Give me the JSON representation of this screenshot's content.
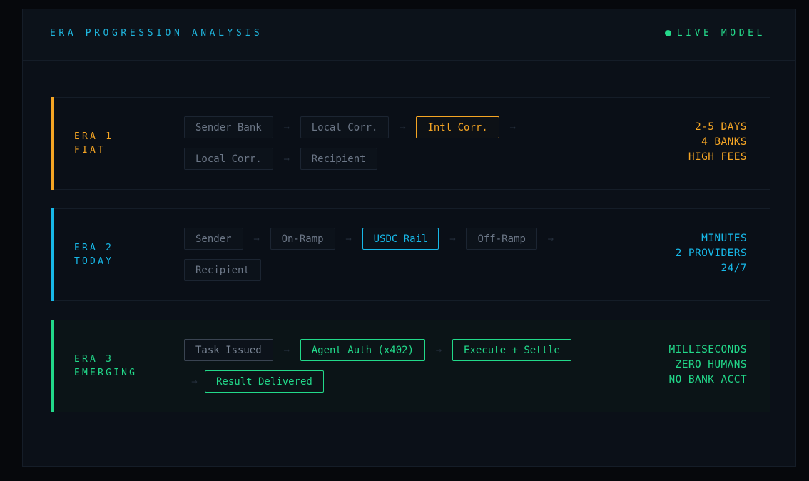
{
  "header": {
    "title": "ERA PROGRESSION ANALYSIS",
    "status": "LIVE MODEL"
  },
  "colors": {
    "era1": "#f5a524",
    "era2": "#17b8e8",
    "era3": "#22d98a",
    "muted": "#6c7787"
  },
  "eras": [
    {
      "label_line1": "ERA 1",
      "label_line2": "FIAT",
      "flow": [
        "Sender Bank",
        "Local Corr.",
        "Intl Corr.",
        "Local Corr.",
        "Recipient"
      ],
      "highlighted": "Intl Corr.",
      "stats": [
        "2-5 DAYS",
        "4 BANKS",
        "HIGH FEES"
      ]
    },
    {
      "label_line1": "ERA 2",
      "label_line2": "TODAY",
      "flow": [
        "Sender",
        "On-Ramp",
        "USDC Rail",
        "Off-Ramp",
        "Recipient"
      ],
      "highlighted": "USDC Rail",
      "stats": [
        "MINUTES",
        "2 PROVIDERS",
        "24/7"
      ]
    },
    {
      "label_line1": "ERA 3",
      "label_line2": "EMERGING",
      "flow": [
        "Task Issued",
        "Agent Auth (x402)",
        "Execute + Settle",
        "Result Delivered"
      ],
      "highlighted": "Agent Auth (x402), Execute + Settle, Result Delivered",
      "stats": [
        "MILLISECONDS",
        "ZERO HUMANS",
        "NO BANK ACCT"
      ]
    }
  ],
  "icons": {
    "arrow": "arrow-right-icon",
    "status": "status-dot-icon"
  }
}
